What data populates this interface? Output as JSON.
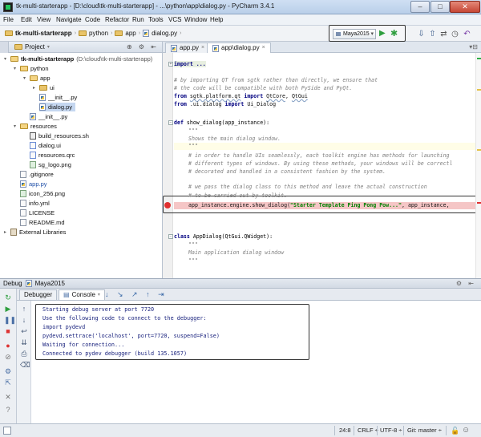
{
  "window": {
    "title": "tk-multi-starterapp - [D:\\cloud\\tk-multi-starterapp] - ...\\python\\app\\dialog.py - PyCharm 3.4.1",
    "minimize": "–",
    "maximize": "□",
    "close": "✕"
  },
  "menu": [
    "File",
    "Edit",
    "View",
    "Navigate",
    "Code",
    "Refactor",
    "Run",
    "Tools",
    "VCS",
    "Window",
    "Help"
  ],
  "breadcrumb": [
    "tk-multi-starterapp",
    "python",
    "app",
    "dialog.py"
  ],
  "run_config": {
    "selected": "Maya2015"
  },
  "project_panel": {
    "title": "Project",
    "tree": [
      {
        "label": "tk-multi-starterapp",
        "path": "(D:\\cloud\\tk-multi-starterapp)",
        "kind": "folder",
        "open": true
      },
      {
        "label": "python",
        "kind": "folder",
        "open": true
      },
      {
        "label": "app",
        "kind": "folder",
        "open": true
      },
      {
        "label": "ui",
        "kind": "folder",
        "open": false
      },
      {
        "label": "__init__.py",
        "kind": "py"
      },
      {
        "label": "dialog.py",
        "kind": "py",
        "selected": true
      },
      {
        "label": "__init__.py",
        "kind": "py"
      },
      {
        "label": "resources",
        "kind": "folder",
        "open": true
      },
      {
        "label": "build_resources.sh",
        "kind": "sh"
      },
      {
        "label": "dialog.ui",
        "kind": "ui"
      },
      {
        "label": "resources.qrc",
        "kind": "ui"
      },
      {
        "label": "sg_logo.png",
        "kind": "png"
      },
      {
        "label": ".gitignore",
        "kind": "file"
      },
      {
        "label": "app.py",
        "kind": "py"
      },
      {
        "label": "icon_256.png",
        "kind": "png"
      },
      {
        "label": "info.yml",
        "kind": "file"
      },
      {
        "label": "LICENSE",
        "kind": "file"
      },
      {
        "label": "README.md",
        "kind": "file"
      },
      {
        "label": "External Libraries",
        "kind": "lib"
      }
    ]
  },
  "editor_tabs": [
    {
      "label": "app.py",
      "active": false
    },
    {
      "label": "app\\dialog.py",
      "active": true
    }
  ],
  "code": {
    "l1": "import ...",
    "l2": "# by importing QT from sgtk rather than directly, we ensure that",
    "l3": "# the code will be compatible with both PySide and PyQt.",
    "l4a": "from ",
    "l4b": "sgtk.platform.qt",
    "l4c": " import ",
    "l4d": "QtCore",
    "l4e": ", ",
    "l4f": "QtGui",
    "l5a": "from ",
    "l5b": ".ui.dialog",
    "l5c": " import ",
    "l5d": "Ui_Dialog",
    "l6a": "def ",
    "l6b": "show_dialog(app_instance):",
    "l7": "\"\"\"",
    "l8": "Shows the main dialog window.",
    "l9": "\"\"\"",
    "l10": "# in order to handle UIs seamlessly, each toolkit engine has methods for launching",
    "l11": "# different types of windows. By using these methods, your windows will be correctl",
    "l12": "# decorated and handled in a consistent fashion by the system.",
    "l13": "# we pass the dialog class to this method and leave the actual construction",
    "l14": "# to be carried out by toolkit.",
    "l15a": "app_instance.engine.show_dialog(",
    "l15b": "\"Starter Template Ping Pong Pow...\"",
    "l15c": ", app_instance, ",
    "l16a": "class ",
    "l16b": "AppDialog(QtGui.QWidget):",
    "l17": "\"\"\"",
    "l18": "Main application dialog window",
    "l19": "\"\"\""
  },
  "debug": {
    "title": "Debug",
    "config": "Maya2015",
    "tabs": [
      "Debugger",
      "Console"
    ],
    "active_tab": "Console",
    "console_lines": [
      "Starting debug server at port 7720",
      "Use the following code to connect to the debugger:",
      "import pydevd",
      "pydevd.settrace('localhost', port=7720, suspend=False)",
      "Waiting for connection...",
      "Connected to pydev debugger (build 135.1057)"
    ]
  },
  "status": {
    "position": "24:8",
    "line_sep": "CRLF ÷",
    "encoding": "UTF-8 ÷",
    "vcs": "Git: master ÷"
  },
  "colors": {
    "breakpoint": "#e03030",
    "breakpoint_line": "#f5c6c6",
    "console_text": "#1a237e",
    "keyword": "#000080",
    "string": "#008000",
    "comment": "#808080"
  }
}
